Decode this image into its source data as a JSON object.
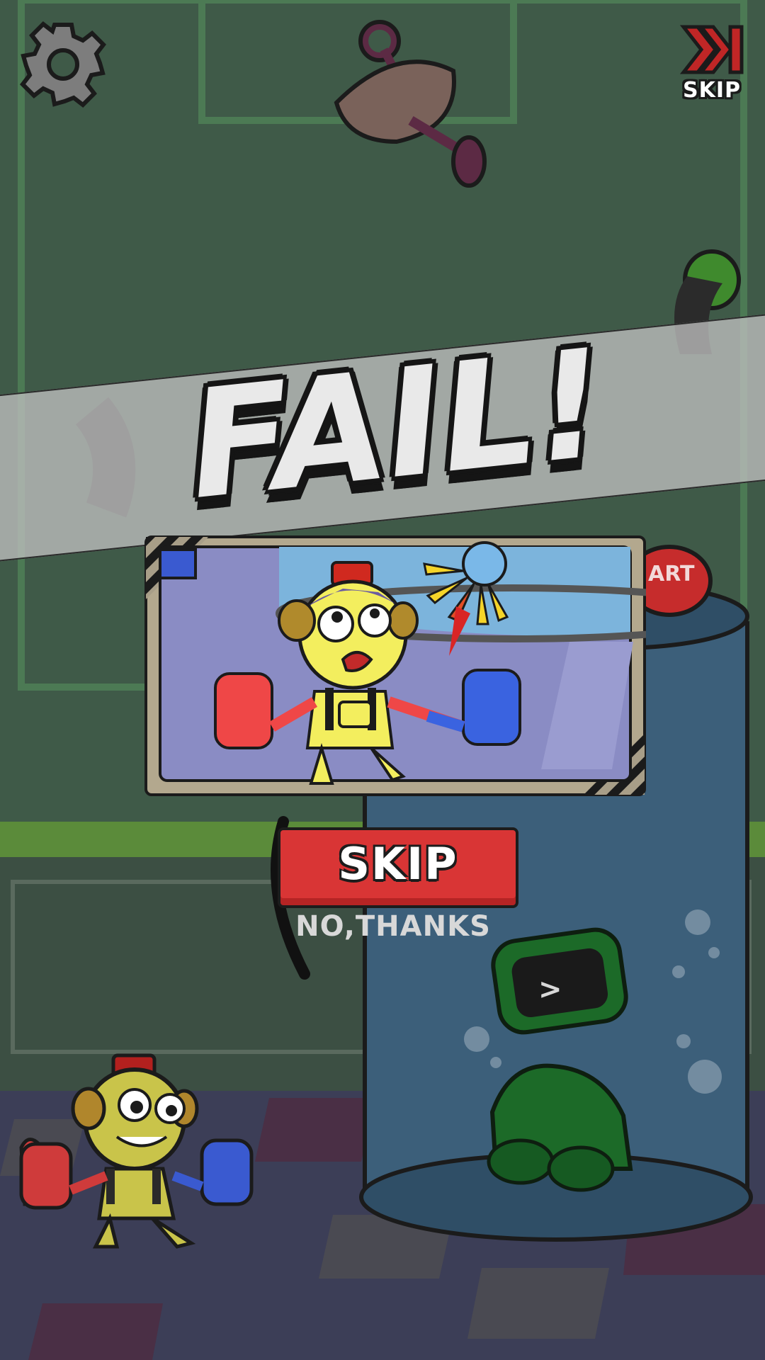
{
  "hud": {
    "settings_icon": "gear-icon",
    "skip_icon": "skip-forward-icon",
    "skip_label": "SKIP"
  },
  "banner": {
    "title": "FAIL!"
  },
  "scene": {
    "start_button_label_partial": "ART"
  },
  "popup": {
    "skip_button_label": "SKIP",
    "no_thanks_label": "NO,THANKS"
  },
  "colors": {
    "wall": "#3f5a48",
    "floor": "#3d3f58",
    "skip_red": "#d93535",
    "glass_tube": "#3c5f7a",
    "banner": "#bebebe"
  }
}
